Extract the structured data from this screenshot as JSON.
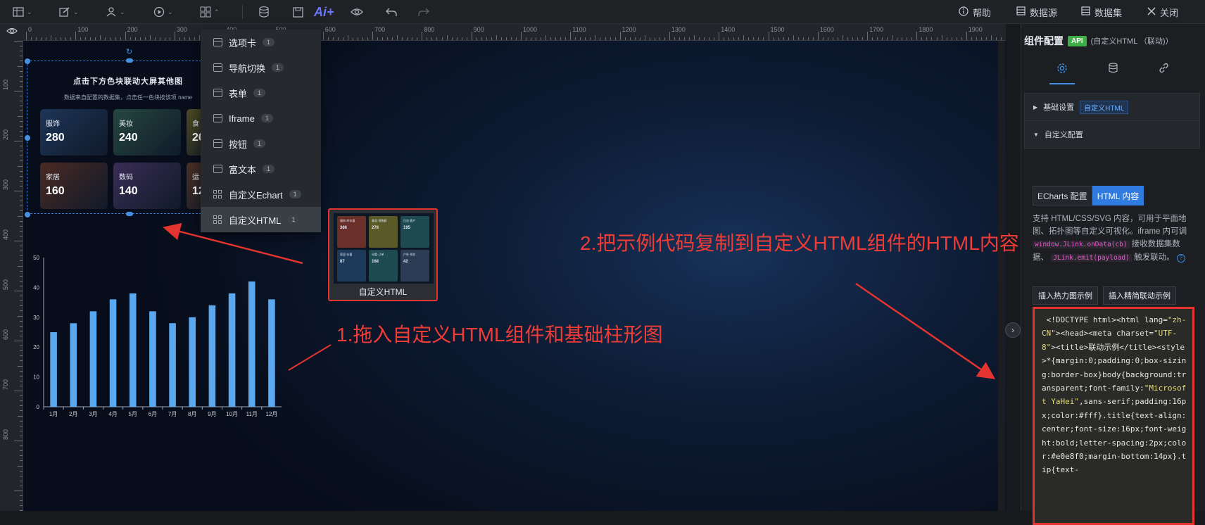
{
  "toolbar": {
    "ai_label": "Ai+",
    "right": [
      {
        "icon": "help-icon",
        "label": "帮助"
      },
      {
        "icon": "datasource-icon",
        "label": "数据源"
      },
      {
        "icon": "dataset-icon",
        "label": "数据集"
      },
      {
        "icon": "close-icon",
        "label": "关闭"
      }
    ]
  },
  "ruler": {
    "h_ticks": [
      "0",
      "100",
      "200",
      "300",
      "400",
      "500",
      "600",
      "700",
      "800",
      "900",
      "1000",
      "1100",
      "1200",
      "1300",
      "1400",
      "1500",
      "1600",
      "1700",
      "1800",
      "1900"
    ],
    "v_ticks": [
      "100",
      "200",
      "300",
      "400",
      "500",
      "600",
      "700",
      "800"
    ]
  },
  "widget": {
    "title": "点击下方色块联动大屏其他图",
    "subtitle": "数据来自配置的数据集，点击任一色块按该项 name",
    "tiles": [
      {
        "name": "服饰",
        "value": "280",
        "color": "#1d3557"
      },
      {
        "name": "美妆",
        "value": "240",
        "color": "#25473f"
      },
      {
        "name": "食",
        "value": "20",
        "color": "#4d4a22"
      },
      {
        "name": "家居",
        "value": "160",
        "color": "#4a2a22"
      },
      {
        "name": "数码",
        "value": "140",
        "color": "#3a2d55"
      },
      {
        "name": "运",
        "value": "12",
        "color": "#4a3026"
      }
    ]
  },
  "menu": {
    "items": [
      {
        "label": "选项卡",
        "count": "1",
        "icon": "tabs-icon"
      },
      {
        "label": "导航切换",
        "count": "1",
        "icon": "nav-switch-icon"
      },
      {
        "label": "表单",
        "count": "1",
        "icon": "form-icon"
      },
      {
        "label": "Iframe",
        "count": "1",
        "icon": "iframe-icon"
      },
      {
        "label": "按钮",
        "count": "1",
        "icon": "button-icon"
      },
      {
        "label": "富文本",
        "count": "1",
        "icon": "richtext-icon"
      },
      {
        "label": "自定义Echart",
        "count": "1",
        "icon": "echart-icon"
      },
      {
        "label": "自定义HTML",
        "count": "1",
        "icon": "html-grid-icon"
      }
    ]
  },
  "thumb": {
    "label": "自定义HTML",
    "tiles": [
      {
        "text": "服饰·库存量",
        "value": "386",
        "color": "#6b2f2a"
      },
      {
        "text": "美妆·销售额",
        "value": "278",
        "color": "#5a5a28"
      },
      {
        "text": "日化·客户",
        "value": "195",
        "color": "#1e4a52"
      },
      {
        "text": "家居·存量",
        "value": "87",
        "color": "#1d3a5a"
      },
      {
        "text": "母婴·订单",
        "value": "168",
        "color": "#1e4a52"
      },
      {
        "text": "户外·排名",
        "value": "42",
        "color": "#2a3d55"
      }
    ]
  },
  "chart_data": {
    "type": "bar",
    "categories": [
      "1月",
      "2月",
      "3月",
      "4月",
      "5月",
      "6月",
      "7月",
      "8月",
      "9月",
      "10月",
      "11月",
      "12月"
    ],
    "values": [
      25,
      28,
      32,
      36,
      38,
      32,
      28,
      30,
      34,
      38,
      42,
      36
    ],
    "ylim": [
      0,
      50
    ],
    "yticks": [
      "0",
      "10",
      "20",
      "30",
      "40",
      "50"
    ],
    "color": "#5aa9f0",
    "grid": false
  },
  "annotations": {
    "step1": "1.拖入自定义HTML组件和基础柱形图",
    "step2": "2.把示例代码复制到自定义HTML组件的HTML内容中"
  },
  "panel": {
    "title": "组件配置",
    "api_badge": "API",
    "context": "(自定义HTML （联动)）",
    "tab_icons": [
      "gear-icon",
      "database-icon",
      "link-icon"
    ],
    "section_basic": "基础设置",
    "section_basic_chip": "自定义HTML",
    "section_custom": "自定义配置",
    "sub_tabs": [
      "ECharts 配置",
      "HTML 内容"
    ],
    "desc_1": "支持 HTML/CSS/SVG 内容，可用于平面地图、拓扑图等自定义可视化。iframe 内可调",
    "code_1": "window.JLink.onData(cb)",
    "desc_2": "接收数据集数据、",
    "code_2": "JLink.emit(payload)",
    "desc_3": "触发联动。",
    "btn_heatmap": "插入热力图示例",
    "btn_linkage": "插入精简联动示例",
    "code_text": " <!DOCTYPE html><html lang=\"zh-CN\"><head><meta charset=\"UTF-8\"><title>联动示例</title><style>*{margin:0;padding:0;box-sizing:border-box}body{background:transparent;font-family:\"Microsoft YaHei\",sans-serif;padding:16px;color:#fff}.title{text-align:center;font-size:16px;font-weight:bold;letter-spacing:2px;color:#e0e8f0;margin-bottom:14px}.tip{text-"
  }
}
